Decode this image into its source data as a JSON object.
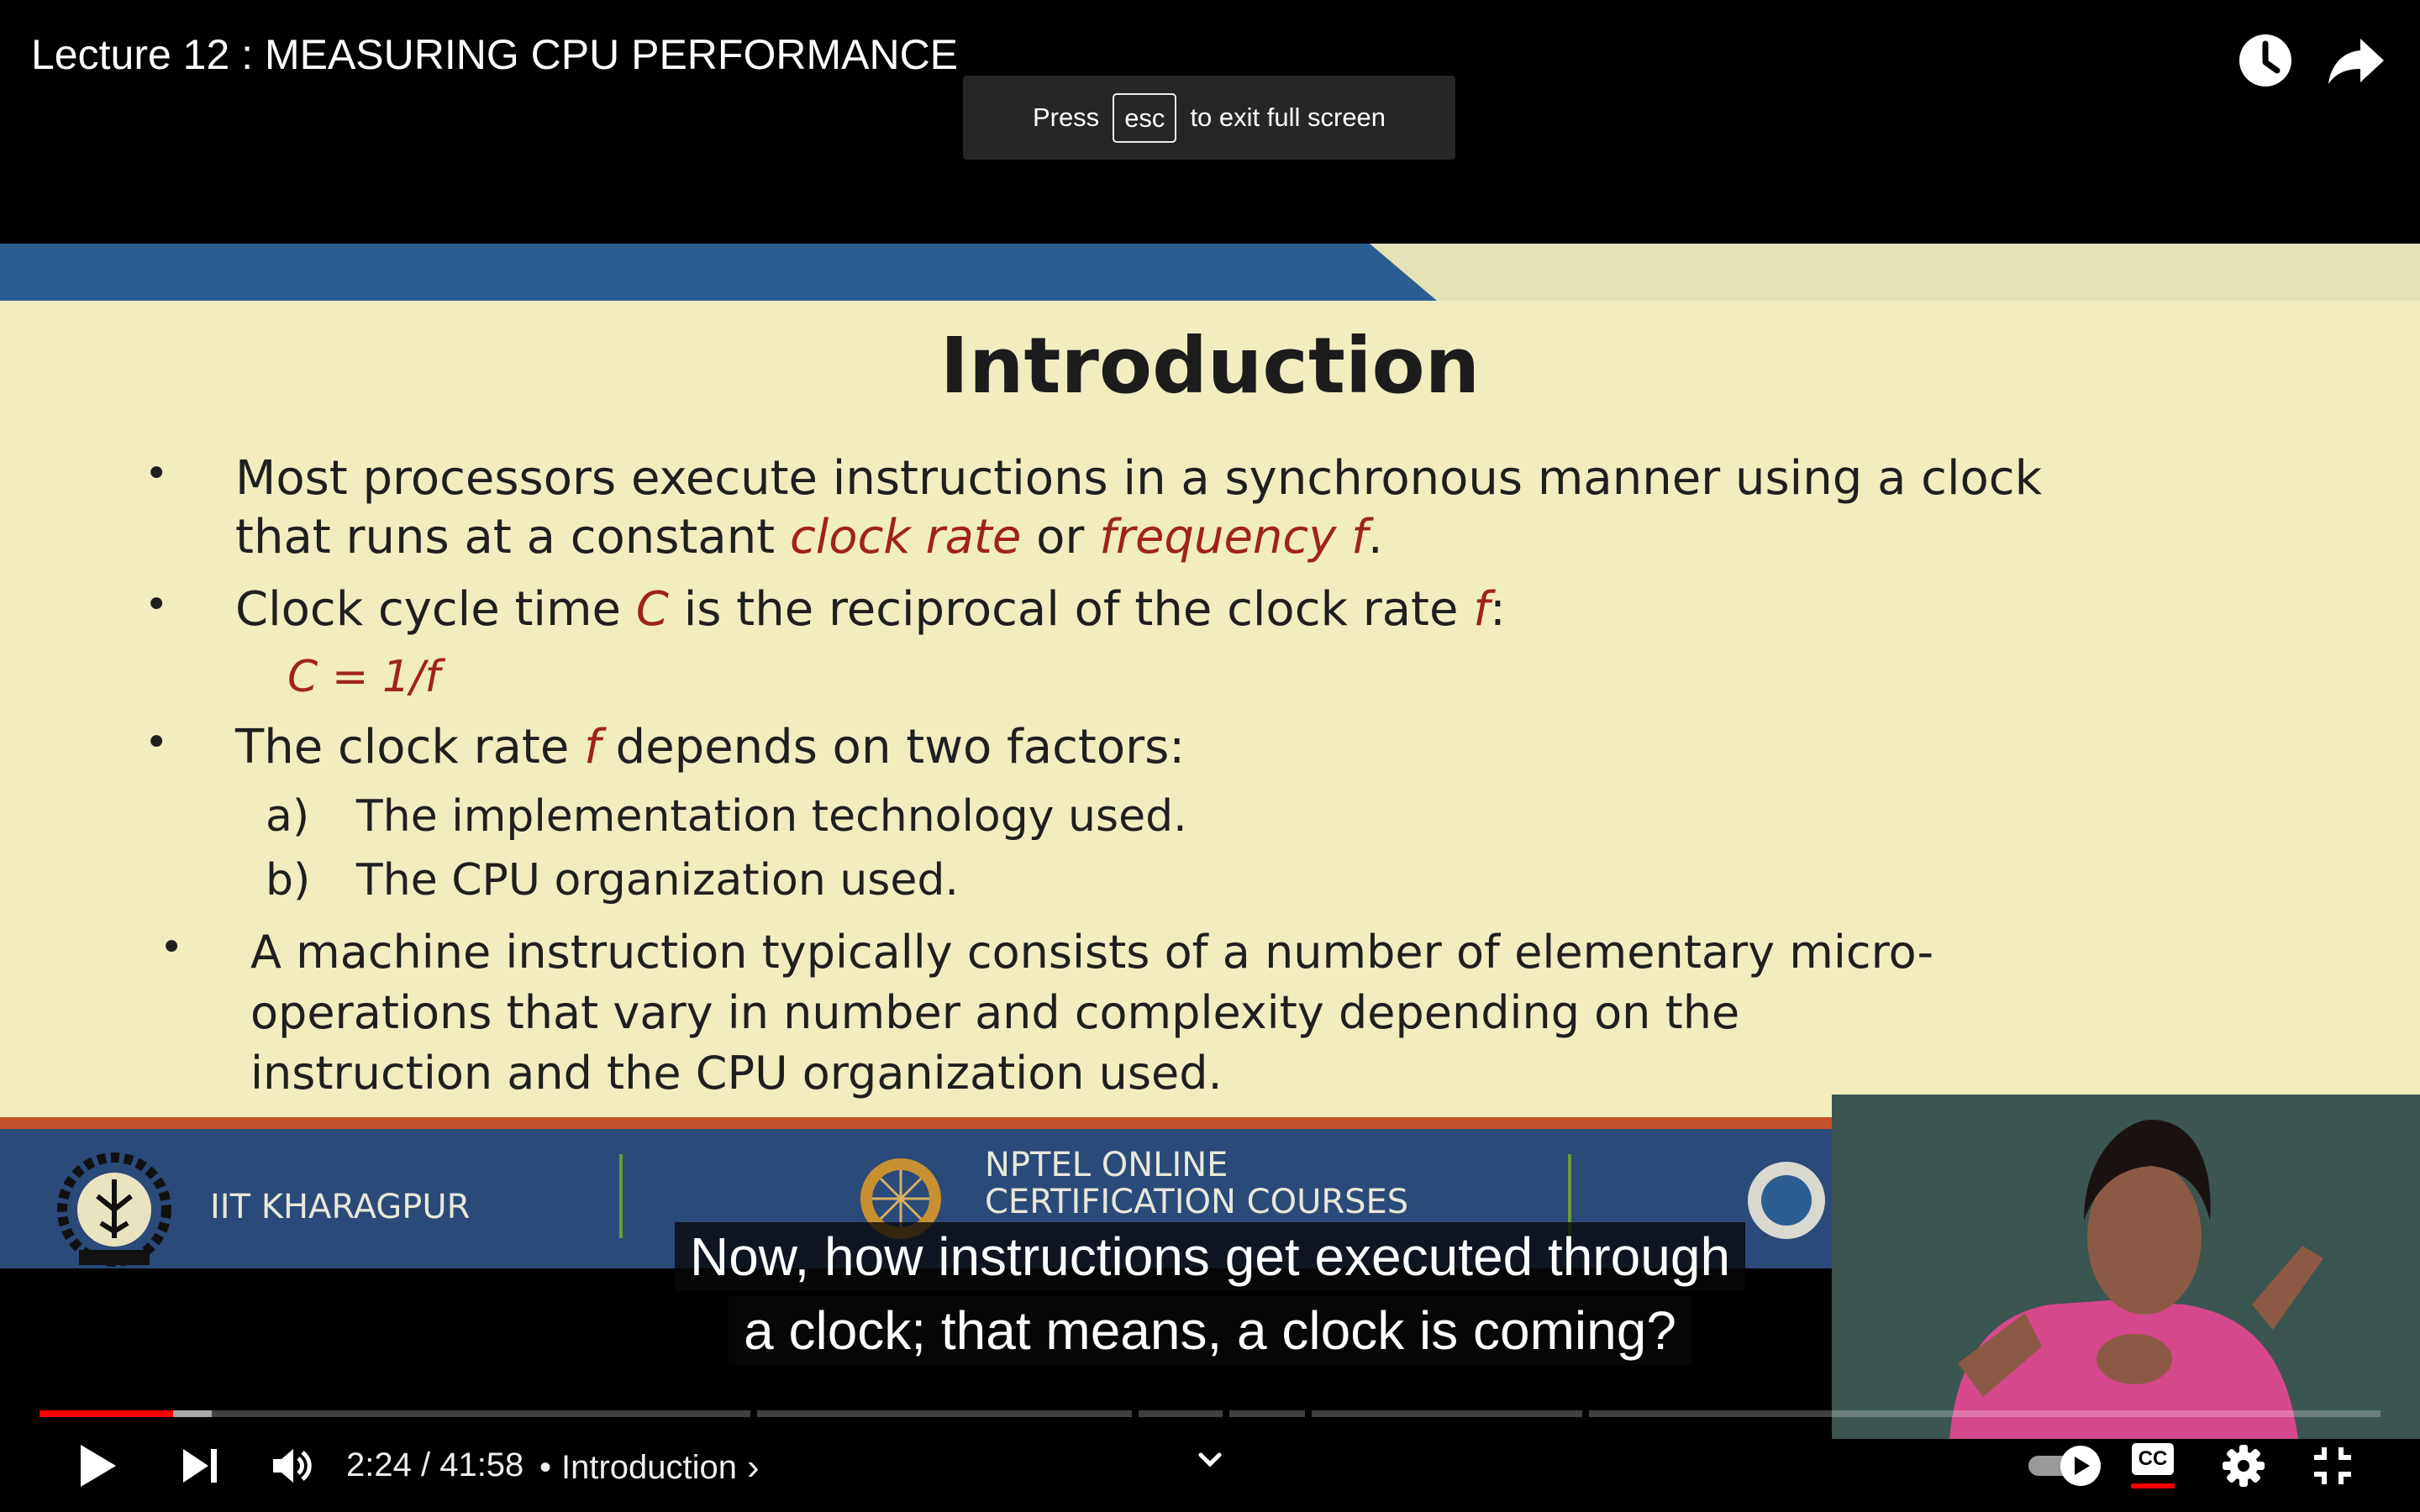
{
  "header": {
    "title": "Lecture 12 : MEASURING CPU PERFORMANCE",
    "watch_later_icon": "clock-icon",
    "share_icon": "share-arrow-icon"
  },
  "fullscreen_toast": {
    "press": "Press",
    "key": "esc",
    "rest": "to exit full screen"
  },
  "slide": {
    "heading": "Introduction",
    "bullets": {
      "b1": {
        "line1": "Most processors execute instructions in a synchronous manner using a clock",
        "line2_pre": "that runs at a constant ",
        "line2_em1": "clock rate",
        "line2_mid": " or ",
        "line2_em2": "frequency f",
        "line2_end": "."
      },
      "b2": {
        "pre": "Clock cycle time ",
        "em1": "C",
        "mid": " is the reciprocal of the clock rate ",
        "em2": "f",
        "end": ":",
        "formula": "C = 1/f"
      },
      "b3": {
        "pre": "The clock rate ",
        "em": "f",
        "post": " depends on two factors:",
        "sub_a_marker": "a)",
        "sub_a": "The implementation technology used.",
        "sub_b_marker": "b)",
        "sub_b": "The CPU organization used."
      },
      "b4": {
        "line1": "A machine instruction typically consists of a number of elementary micro-",
        "line2": "operations that vary in number and complexity depending on the",
        "line3": "instruction and the CPU organization used."
      }
    },
    "footer": {
      "institute": "IIT KHARAGPUR",
      "nptel_line1": "NPTEL ONLINE",
      "nptel_line2": "CERTIFICATION COURSES"
    }
  },
  "captions": {
    "line1": "Now, how instructions get executed through",
    "line2": "a clock; that means, a clock is coming?"
  },
  "player": {
    "progress": {
      "played_fraction": 0.0572,
      "buffered_fraction": 0.0735
    },
    "time_current": "2:24",
    "time_separator": " / ",
    "time_total": "41:58",
    "chapter_bullet": "•",
    "chapter": "Introduction",
    "chapter_arrow": "›",
    "icons": {
      "play": "play-icon",
      "next": "next-icon",
      "volume": "volume-icon",
      "expand": "chevron-down-icon",
      "autoplay": "autoplay-toggle-icon",
      "cc": "cc-icon",
      "settings": "gear-icon",
      "exit_fullscreen": "exit-fullscreen-icon"
    },
    "cc_label": "CC",
    "accent_color": "#ff0000"
  }
}
